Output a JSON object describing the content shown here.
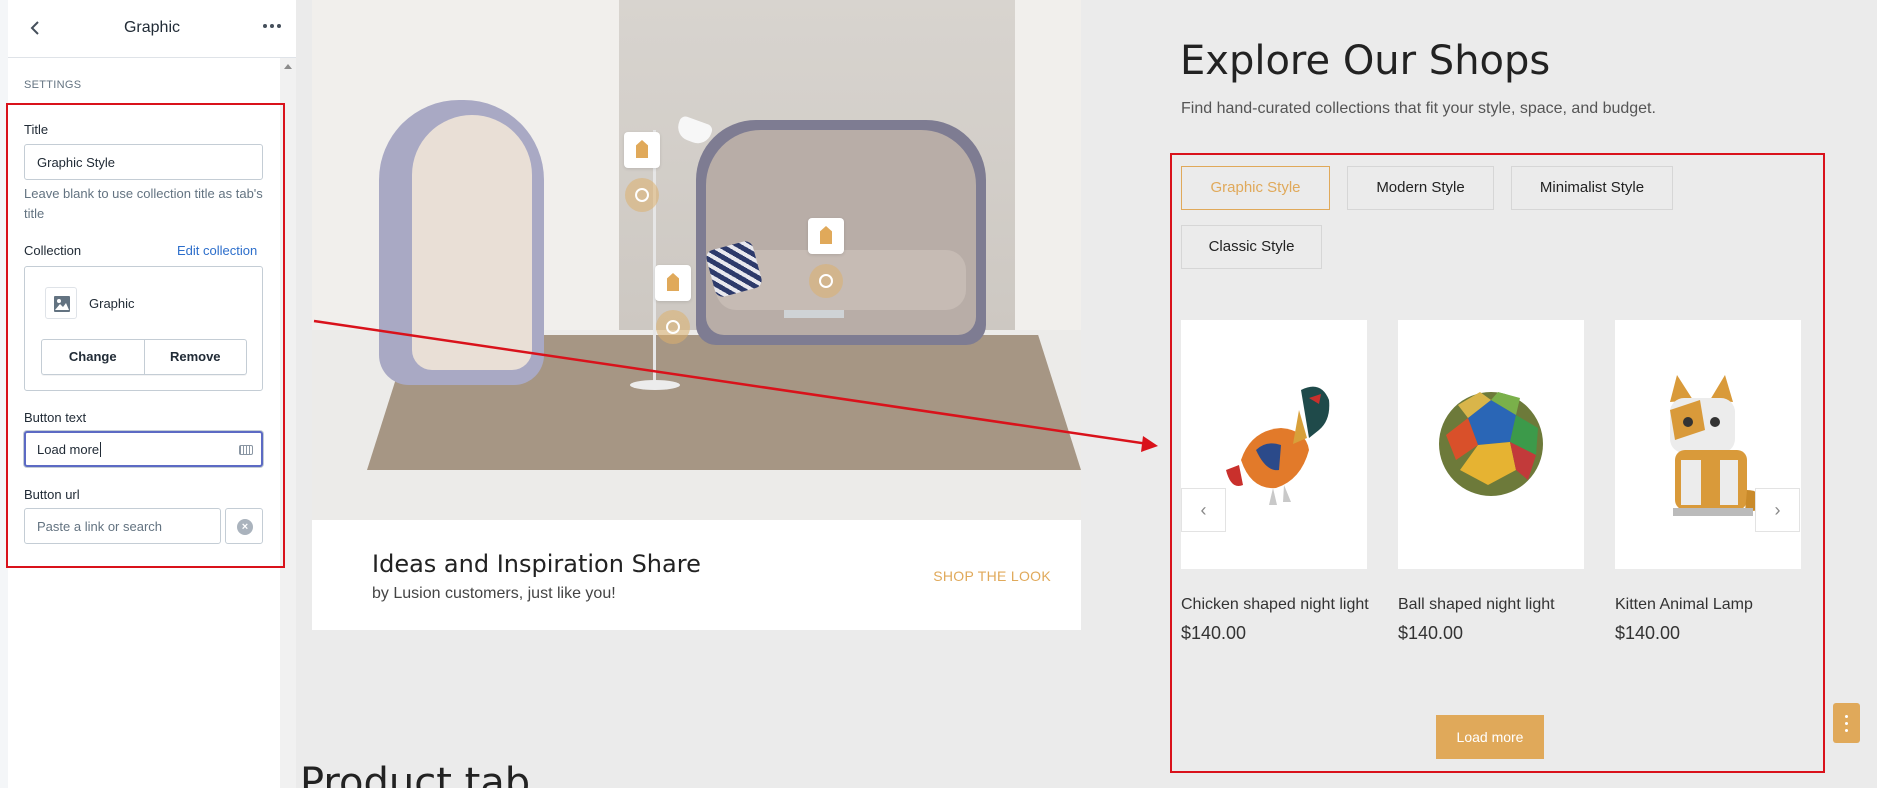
{
  "sidebar": {
    "header_title": "Graphic",
    "back_icon": "chevron-left-icon",
    "more_icon": "ellipsis-icon",
    "section_label": "SETTINGS",
    "title_label": "Title",
    "title_value": "Graphic Style",
    "title_help": "Leave blank to use collection title as tab's title",
    "collection_label": "Collection",
    "edit_collection": "Edit collection",
    "collection_name": "Graphic",
    "change_label": "Change",
    "remove_label": "Remove",
    "button_text_label": "Button text",
    "button_text_value": "Load more",
    "button_url_label": "Button url",
    "button_url_placeholder": "Paste a link or search"
  },
  "inspiration": {
    "title": "Ideas and Inspiration Share",
    "subtitle": "by Lusion customers, just like you!",
    "link": "SHOP THE LOOK"
  },
  "explore": {
    "title": "Explore Our Shops",
    "subtitle": "Find hand-curated collections that fit your style, space, and budget.",
    "tabs": [
      {
        "label": "Graphic Style",
        "active": true
      },
      {
        "label": "Modern Style",
        "active": false
      },
      {
        "label": "Minimalist Style",
        "active": false
      },
      {
        "label": "Classic Style",
        "active": false
      }
    ],
    "products": [
      {
        "name": "Chicken shaped night light",
        "price": "$140.00"
      },
      {
        "name": "Ball shaped night light",
        "price": "$140.00"
      },
      {
        "name": "Kitten Animal Lamp",
        "price": "$140.00"
      }
    ],
    "load_more": "Load more"
  },
  "next_section_heading": "Product tab",
  "colors": {
    "accent": "#e0a95a",
    "annotation": "#d9121b",
    "link": "#2c6ecb"
  }
}
